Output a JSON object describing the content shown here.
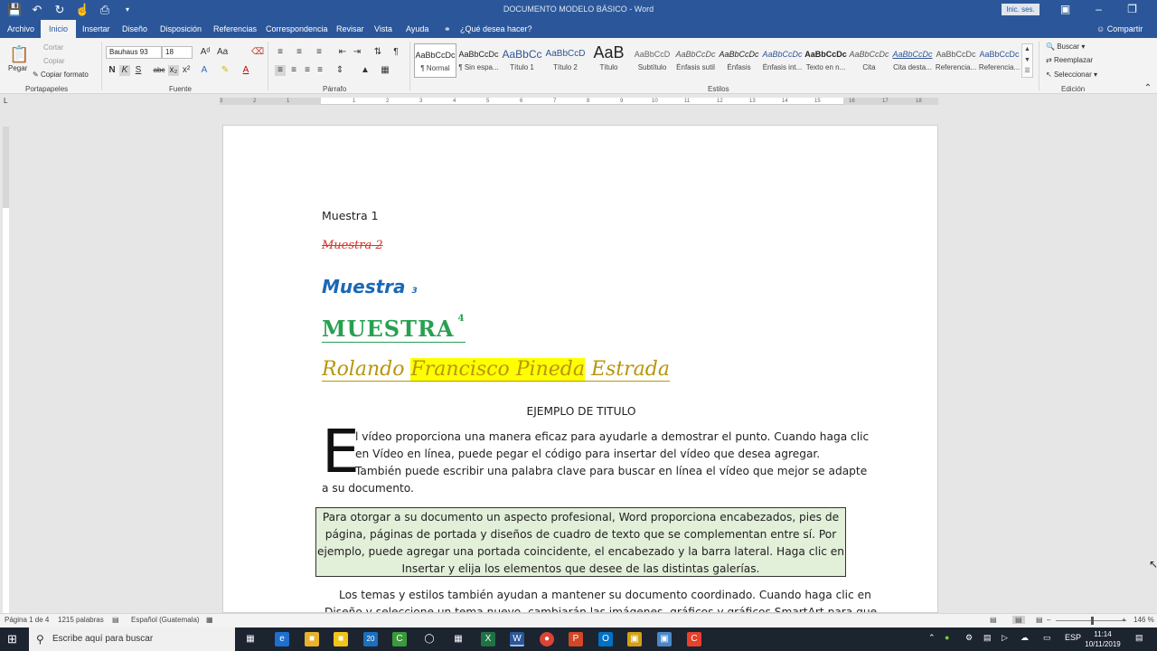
{
  "window": {
    "title": "DOCUMENTO MODELO BÁSICO  -  Word",
    "signin_label": "Inic. ses.",
    "share_label": "Compartir"
  },
  "tabs": [
    "Archivo",
    "Inicio",
    "Insertar",
    "Diseño",
    "Disposición",
    "Referencias",
    "Correspondencia",
    "Revisar",
    "Vista",
    "Ayuda"
  ],
  "tell_me": "¿Qué desea hacer?",
  "ribbon": {
    "clipboard": {
      "paste": "Pegar",
      "cut": "Cortar",
      "copy": "Copiar",
      "format_painter": "Copiar formato",
      "group": "Portapapeles"
    },
    "font": {
      "family": "Bauhaus 93",
      "size": "18",
      "group": "Fuente",
      "bold": "N",
      "italic": "K",
      "underline": "S",
      "strike": "abc"
    },
    "paragraph": {
      "group": "Párrafo"
    },
    "styles": {
      "group": "Estilos",
      "items": [
        {
          "preview": "AaBbCcDc",
          "label": "¶ Normal"
        },
        {
          "preview": "AaBbCcDc",
          "label": "¶ Sin espa..."
        },
        {
          "preview": "AaBbCc",
          "label": "Título 1"
        },
        {
          "preview": "AaBbCcD",
          "label": "Título 2"
        },
        {
          "preview": "AaB",
          "label": "Título"
        },
        {
          "preview": "AaBbCcD",
          "label": "Subtítulo"
        },
        {
          "preview": "AaBbCcDc",
          "label": "Énfasis sutil"
        },
        {
          "preview": "AaBbCcDc",
          "label": "Énfasis"
        },
        {
          "preview": "AaBbCcDc",
          "label": "Énfasis int..."
        },
        {
          "preview": "AaBbCcDc",
          "label": "Texto en n..."
        },
        {
          "preview": "AaBbCcDc",
          "label": "Cita"
        },
        {
          "preview": "AaBbCcDc",
          "label": "Cita desta..."
        },
        {
          "preview": "AaBbCcDc",
          "label": "Referencia..."
        },
        {
          "preview": "AaBbCcDc",
          "label": "Referencia..."
        }
      ]
    },
    "editing": {
      "find": "Buscar",
      "replace": "Reemplazar",
      "select": "Seleccionar",
      "group": "Edición"
    }
  },
  "ruler_numbers": [
    "3",
    "2",
    "1",
    "1",
    "2",
    "3",
    "4",
    "5",
    "6",
    "7",
    "8",
    "9",
    "10",
    "11",
    "12",
    "13",
    "14",
    "15",
    "16",
    "17",
    "18"
  ],
  "document": {
    "sample1": "Muestra 1",
    "sample2": "Muestra 2",
    "sample3": "Muestra",
    "sample3_num": "3",
    "sample4": "MUESTRA",
    "sample4_num": "4",
    "name_part1": "Rolando ",
    "name_highlight": "Francisco Pineda",
    "name_part2": " Estrada",
    "heading": "EJEMPLO DE TITULO",
    "dropcap": "E",
    "para1": [
      "l vídeo proporciona una manera eficaz para ayudarle a demostrar el punto. Cuando haga clic",
      "en Vídeo en línea, puede pegar el código para insertar del vídeo que desea agregar.",
      "También puede escribir una palabra clave para buscar en línea el vídeo que mejor se adapte",
      "a su documento."
    ],
    "para2": [
      "Para otorgar a su documento un aspecto profesional, Word proporciona encabezados, pies de",
      "página, páginas de portada y diseños de cuadro de texto que se complementan entre sí. Por",
      "ejemplo, puede agregar una portada coincidente, el encabezado y la barra lateral. Haga clic en",
      "Insertar y elija los elementos que desee de las distintas galerías."
    ],
    "para3": [
      "Los temas y estilos también ayudan a mantener su documento coordinado. Cuando haga clic en",
      "Diseño y seleccione un tema nuevo, cambiarán las imágenes, gráficos y gráficos SmartArt para que"
    ]
  },
  "status": {
    "page": "Página 1 de 4",
    "words": "1215 palabras",
    "language": "Español (Guatemala)",
    "zoom": "146 %"
  },
  "taskbar": {
    "search_placeholder": "Escribe aquí para buscar",
    "lang": "ESP",
    "time": "11:14",
    "date": "10/11/2019"
  }
}
